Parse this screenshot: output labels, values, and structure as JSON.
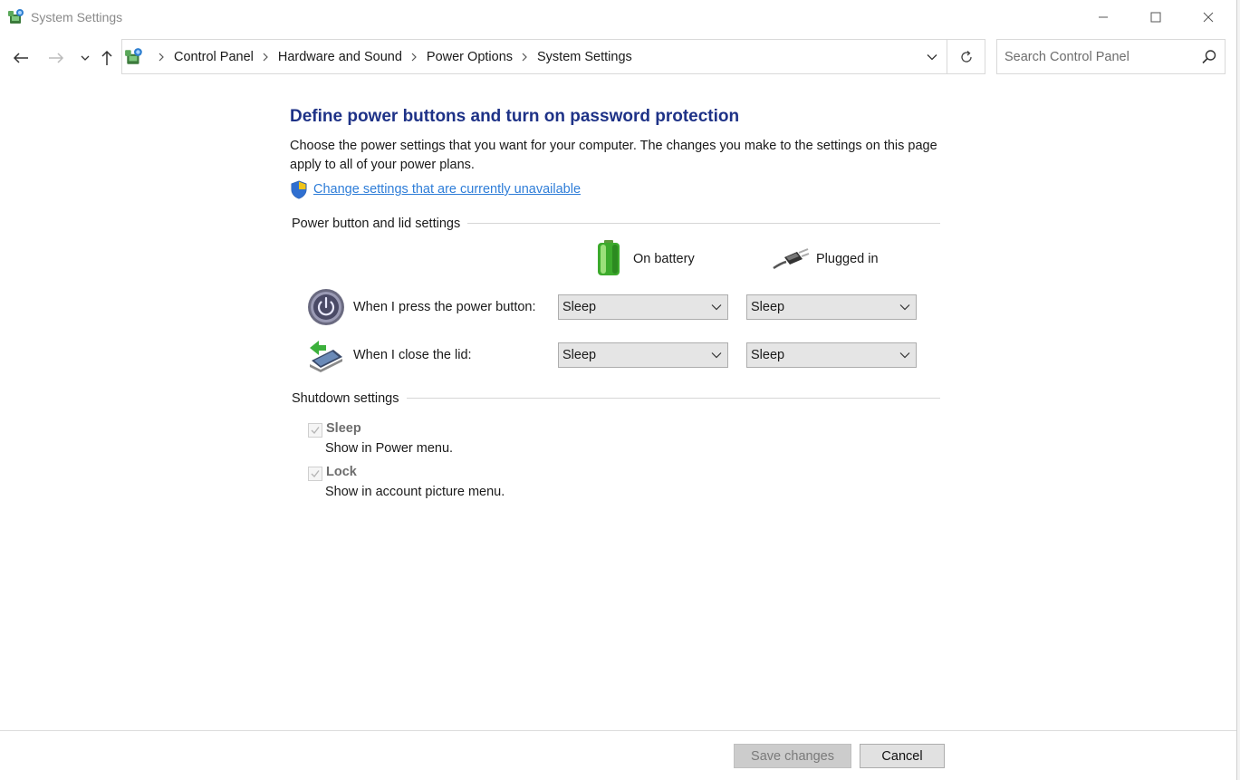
{
  "window": {
    "title": "System Settings",
    "icon": "control-panel-icon",
    "controls": [
      "minimize-icon",
      "maximize-icon",
      "close-icon"
    ]
  },
  "nav": {
    "breadcrumbs": [
      {
        "label": "Control Panel"
      },
      {
        "label": "Hardware and Sound"
      },
      {
        "label": "Power Options"
      },
      {
        "label": "System Settings"
      }
    ],
    "search_placeholder": "Search Control Panel"
  },
  "main": {
    "title": "Define power buttons and turn on password protection",
    "description": "Choose the power settings that you want for your computer. The changes you make to the settings on this page apply to all of your power plans.",
    "change_link": "Change settings that are currently unavailable",
    "power_section": {
      "heading": "Power button and lid settings",
      "columns": {
        "battery": "On battery",
        "plugged": "Plugged in"
      },
      "rows": [
        {
          "label": "When I press the power button:",
          "battery": "Sleep",
          "plugged": "Sleep"
        },
        {
          "label": "When I close the lid:",
          "battery": "Sleep",
          "plugged": "Sleep"
        }
      ]
    },
    "shutdown_section": {
      "heading": "Shutdown settings",
      "options": [
        {
          "title": "Sleep",
          "description": "Show in Power menu.",
          "checked": true,
          "disabled": true
        },
        {
          "title": "Lock",
          "description": "Show in account picture menu.",
          "checked": true,
          "disabled": true
        }
      ]
    }
  },
  "footer": {
    "save_label": "Save changes",
    "cancel_label": "Cancel"
  },
  "colors": {
    "title_blue": "#1e3287",
    "link_blue": "#2e7dd8"
  }
}
